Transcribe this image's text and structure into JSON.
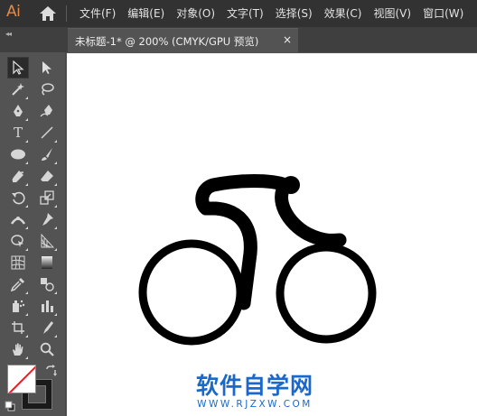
{
  "app": {
    "logo": "Ai"
  },
  "menu": [
    "文件(F)",
    "编辑(E)",
    "对象(O)",
    "文字(T)",
    "选择(S)",
    "效果(C)",
    "视图(V)",
    "窗口(W)"
  ],
  "tab": {
    "title": "未标题-1* @ 200% (CMYK/GPU 预览)",
    "close_glyph": "×"
  },
  "toolbar": {
    "collapse_glyph": "◂◂",
    "type_tool_glyph": "T",
    "tools": [
      "selection-tool",
      "direct-selection-tool",
      "magic-wand-tool",
      "lasso-tool",
      "pen-tool",
      "curvature-tool",
      "type-tool",
      "line-segment-tool",
      "ellipse-tool",
      "paintbrush-tool",
      "shaper-tool",
      "eraser-tool",
      "rotate-tool",
      "scale-tool",
      "width-tool",
      "puppet-warp-tool",
      "shape-builder-tool",
      "perspective-grid-tool",
      "mesh-tool",
      "gradient-tool",
      "eyedropper-tool",
      "blend-tool",
      "symbol-sprayer-tool",
      "column-graph-tool",
      "artboard-tool",
      "slice-tool",
      "hand-tool",
      "zoom-tool"
    ],
    "active_tool": "selection-tool",
    "fill": "none",
    "stroke": "#000000"
  },
  "watermark": {
    "title": "软件自学网",
    "url": "WWW.RJZXW.COM",
    "color": "#1a68c9"
  },
  "colors": {
    "menubar": "#323232",
    "panel": "#535353",
    "logo": "#E08A4C"
  }
}
